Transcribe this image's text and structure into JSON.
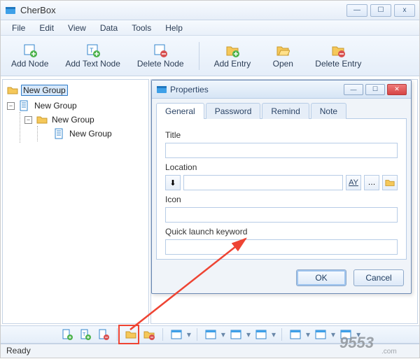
{
  "app": {
    "title": "CherBox"
  },
  "window_controls": {
    "min": "—",
    "max": "☐",
    "close": "x"
  },
  "menu": [
    "File",
    "Edit",
    "View",
    "Data",
    "Tools",
    "Help"
  ],
  "toolbar": {
    "add_node": "Add Node",
    "add_text_node": "Add Text Node",
    "delete_node": "Delete Node",
    "add_entry": "Add Entry",
    "open": "Open",
    "delete_entry": "Delete Entry"
  },
  "tree": {
    "root": "New Group",
    "child1": "New Group",
    "child2": "New Group",
    "child3": "New Group"
  },
  "dialog": {
    "title": "Properties",
    "tabs": {
      "general": "General",
      "password": "Password",
      "remind": "Remind",
      "note": "Note"
    },
    "fields": {
      "title_label": "Title",
      "title_value": "",
      "location_label": "Location",
      "location_value": "",
      "icon_label": "Icon",
      "icon_value": "",
      "keyword_label": "Quick launch keyword",
      "keyword_value": ""
    },
    "buttons": {
      "ok": "OK",
      "cancel": "Cancel"
    }
  },
  "status": {
    "text": "Ready"
  },
  "watermark": {
    "text": "9553",
    "sub": ".com"
  }
}
